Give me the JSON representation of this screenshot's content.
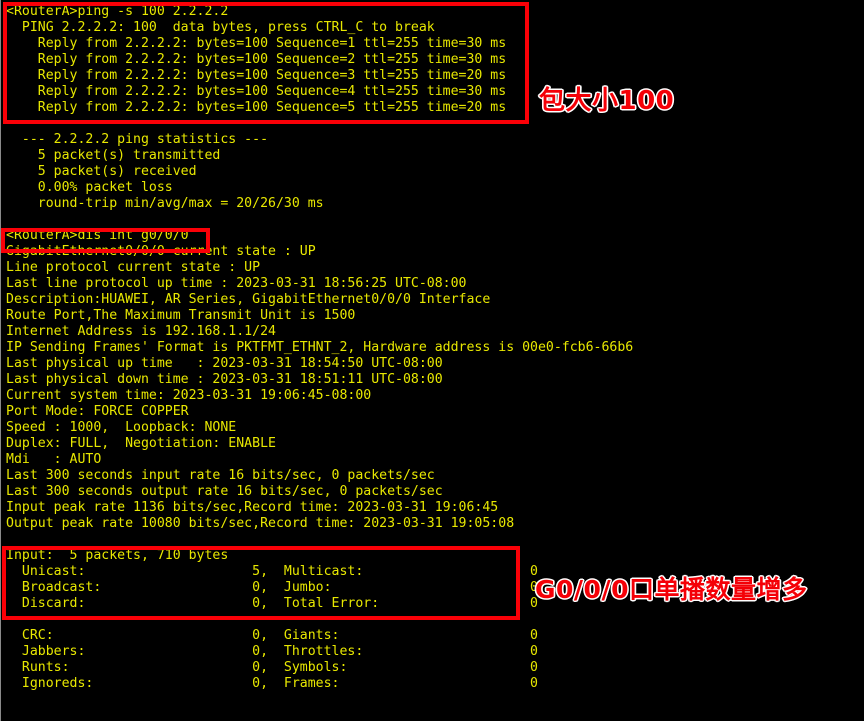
{
  "terminal": {
    "app": "huawei-router-cli",
    "background_color": "#000000",
    "text_color": "#e8e800",
    "highlight_color": "#fb0007",
    "annotation_color": "#f40007",
    "annotation_outline_color": "#ffffff",
    "prompt": "<RouterA>",
    "output": "<RouterA>ping -s 100 2.2.2.2\n  PING 2.2.2.2: 100  data bytes, press CTRL_C to break\n    Reply from 2.2.2.2: bytes=100 Sequence=1 ttl=255 time=30 ms\n    Reply from 2.2.2.2: bytes=100 Sequence=2 ttl=255 time=30 ms\n    Reply from 2.2.2.2: bytes=100 Sequence=3 ttl=255 time=20 ms\n    Reply from 2.2.2.2: bytes=100 Sequence=4 ttl=255 time=30 ms\n    Reply from 2.2.2.2: bytes=100 Sequence=5 ttl=255 time=20 ms\n\n  --- 2.2.2.2 ping statistics ---\n    5 packet(s) transmitted\n    5 packet(s) received\n    0.00% packet loss\n    round-trip min/avg/max = 20/26/30 ms\n\n<RouterA>dis int g0/0/0\nGigabitEthernet0/0/0 current state : UP\nLine protocol current state : UP\nLast line protocol up time : 2023-03-31 18:56:25 UTC-08:00\nDescription:HUAWEI, AR Series, GigabitEthernet0/0/0 Interface\nRoute Port,The Maximum Transmit Unit is 1500\nInternet Address is 192.168.1.1/24\nIP Sending Frames' Format is PKTFMT_ETHNT_2, Hardware address is 00e0-fcb6-66b6\nLast physical up time   : 2023-03-31 18:54:50 UTC-08:00\nLast physical down time : 2023-03-31 18:51:11 UTC-08:00\nCurrent system time: 2023-03-31 19:06:45-08:00\nPort Mode: FORCE COPPER\nSpeed : 1000,  Loopback: NONE\nDuplex: FULL,  Negotiation: ENABLE\nMdi   : AUTO\nLast 300 seconds input rate 16 bits/sec, 0 packets/sec\nLast 300 seconds output rate 16 bits/sec, 0 packets/sec\nInput peak rate 1136 bits/sec,Record time: 2023-03-31 19:06:45\nOutput peak rate 10080 bits/sec,Record time: 2023-03-31 19:05:08\n\nInput:  5 packets, 710 bytes\n  Unicast:                     5,  Multicast:                     0\n  Broadcast:                   0,  Jumbo:                         0\n  Discard:                     0,  Total Error:                   0\n\n  CRC:                         0,  Giants:                        0\n  Jabbers:                     0,  Throttles:                     0\n  Runts:                       0,  Symbols:                       0\n  Ignoreds:                    0,  Frames:                        0"
  },
  "commands": {
    "ping": "ping -s 100 2.2.2.2",
    "display_interface": "dis int g0/0/0"
  },
  "ping_summary": {
    "target": "2.2.2.2",
    "data_bytes": "100",
    "transmitted": "5 packet(s) transmitted",
    "received": "5 packet(s) received",
    "loss": "0.00% packet loss",
    "round_trip": "round-trip min/avg/max = 20/26/30 ms",
    "replies": [
      "Reply from 2.2.2.2: bytes=100 Sequence=1 ttl=255 time=30 ms",
      "Reply from 2.2.2.2: bytes=100 Sequence=2 ttl=255 time=30 ms",
      "Reply from 2.2.2.2: bytes=100 Sequence=3 ttl=255 time=20 ms",
      "Reply from 2.2.2.2: bytes=100 Sequence=4 ttl=255 time=30 ms",
      "Reply from 2.2.2.2: bytes=100 Sequence=5 ttl=255 time=20 ms"
    ]
  },
  "interface": {
    "name": "GigabitEthernet0/0/0",
    "current_state": "UP",
    "line_protocol_state": "UP",
    "last_line_protocol_up_time": "2023-03-31 18:56:25 UTC-08:00",
    "description": "HUAWEI, AR Series, GigabitEthernet0/0/0 Interface",
    "mtu": "1500",
    "internet_address": "192.168.1.1/24",
    "frame_format": "PKTFMT_ETHNT_2",
    "hardware_address": "00e0-fcb6-66b6",
    "last_physical_up_time": "2023-03-31 18:54:50 UTC-08:00",
    "last_physical_down_time": "2023-03-31 18:51:11 UTC-08:00",
    "current_system_time": "2023-03-31 19:06:45-08:00",
    "port_mode": "FORCE COPPER",
    "speed": "1000",
    "loopback": "NONE",
    "duplex": "FULL",
    "negotiation": "ENABLE",
    "mdi": "AUTO",
    "input_rate_300s": "16 bits/sec, 0 packets/sec",
    "output_rate_300s": "16 bits/sec, 0 packets/sec",
    "input_peak_rate": "1136 bits/sec",
    "input_peak_record_time": "2023-03-31 19:06:45",
    "output_peak_rate": "10080 bits/sec",
    "output_peak_record_time": "2023-03-31 19:05:08"
  },
  "input_counters": {
    "header": "Input:  5 packets, 710 bytes",
    "packets": "5",
    "bytes": "710",
    "rows": [
      {
        "left_label": "Unicast:",
        "left_value": "5",
        "right_label": "Multicast:",
        "right_value": "0"
      },
      {
        "left_label": "Broadcast:",
        "left_value": "0",
        "right_label": "Jumbo:",
        "right_value": "0"
      },
      {
        "left_label": "Discard:",
        "left_value": "0",
        "right_label": "Total Error:",
        "right_value": "0"
      }
    ]
  },
  "error_counters": {
    "rows": [
      {
        "left_label": "CRC:",
        "left_value": "0",
        "right_label": "Giants:",
        "right_value": "0"
      },
      {
        "left_label": "Jabbers:",
        "left_value": "0",
        "right_label": "Throttles:",
        "right_value": "0"
      },
      {
        "left_label": "Runts:",
        "left_value": "0",
        "right_label": "Symbols:",
        "right_value": "0"
      },
      {
        "left_label": "Ignoreds:",
        "left_value": "0",
        "right_label": "Frames:",
        "right_value": "0"
      }
    ]
  },
  "annotations": {
    "packet_size": "包大小100",
    "unicast_increase": "G0/0/0口单播数量增多"
  },
  "highlights": {
    "ping_block": "ping-command-and-replies",
    "display_command": "display-interface-command",
    "input_block": "input-packet-counters"
  }
}
